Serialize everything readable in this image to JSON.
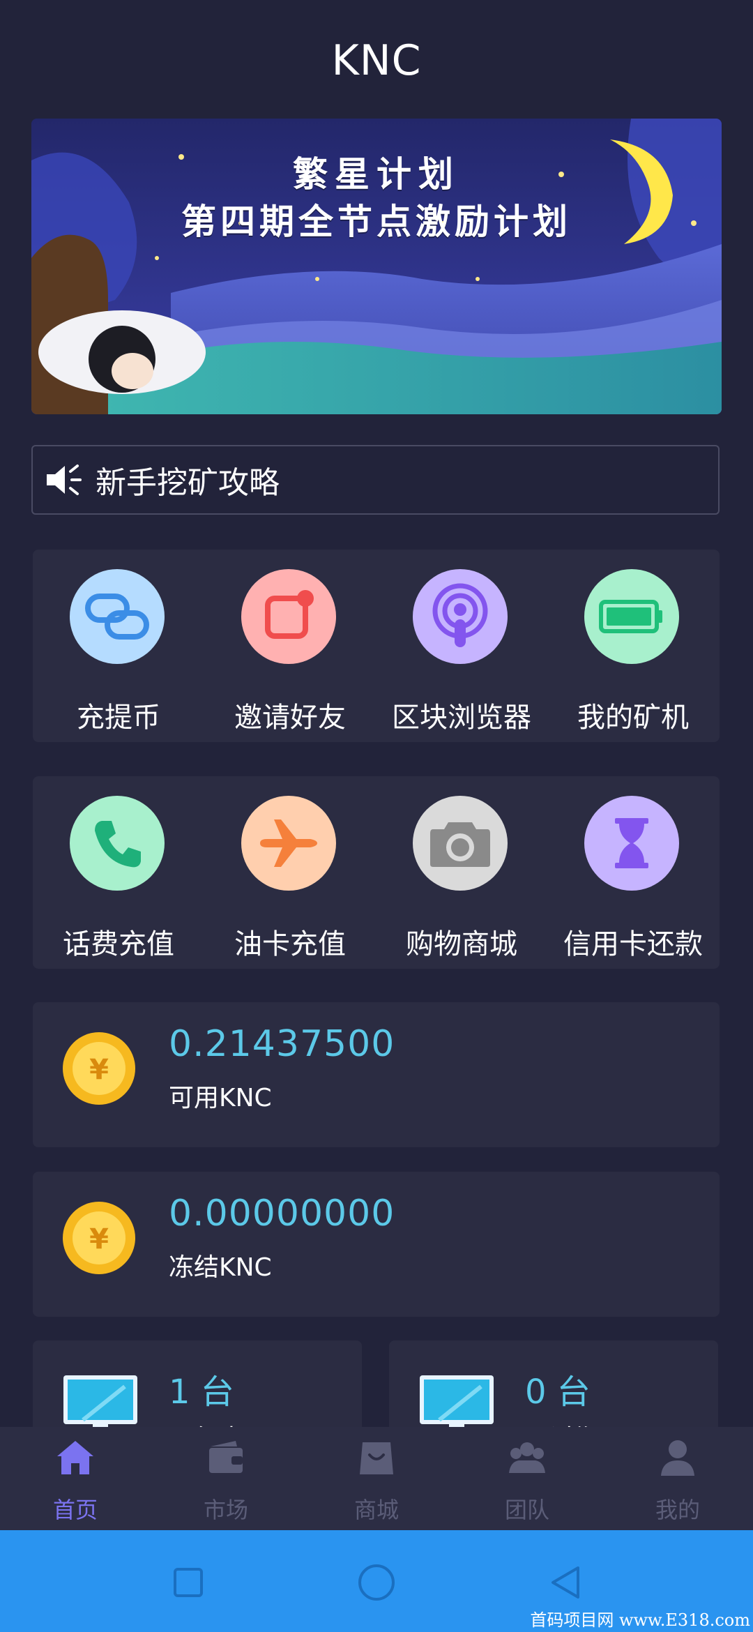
{
  "header": {
    "title": "KNC"
  },
  "banner": {
    "line1": "繁星计划",
    "line2": "第四期全节点激励计划"
  },
  "notice": {
    "text": "新手挖矿攻略",
    "icon": "speaker-icon"
  },
  "grid1": [
    {
      "label": "充提币",
      "icon": "link-icon",
      "color": "#b5dcff"
    },
    {
      "label": "邀请好友",
      "icon": "notification-square-icon",
      "color": "#ffb1b1"
    },
    {
      "label": "区块浏览器",
      "icon": "podcast-icon",
      "color": "#c6b4ff"
    },
    {
      "label": "我的矿机",
      "icon": "battery-icon",
      "color": "#a8f0cd"
    }
  ],
  "grid2": [
    {
      "label": "话费充值",
      "icon": "phone-icon",
      "color": "#a8f0cd"
    },
    {
      "label": "油卡充值",
      "icon": "airplane-icon",
      "color": "#ffcfae"
    },
    {
      "label": "购物商城",
      "icon": "camera-icon",
      "color": "#dadada"
    },
    {
      "label": "信用卡还款",
      "icon": "hourglass-icon",
      "color": "#c6b4ff"
    }
  ],
  "balances": [
    {
      "value": "0.21437500",
      "label": "可用KNC",
      "icon": "yuan-coin-icon"
    },
    {
      "value": "0.00000000",
      "label": "冻结KNC",
      "icon": "yuan-coin-icon"
    }
  ],
  "machines": [
    {
      "value": "1 台",
      "label": "运行中",
      "icon": "monitor-icon"
    },
    {
      "value": "0 台",
      "label": "已过期",
      "icon": "monitor-icon"
    }
  ],
  "tabbar": [
    {
      "label": "首页",
      "icon": "home-icon",
      "active": true
    },
    {
      "label": "市场",
      "icon": "wallet-icon",
      "active": false
    },
    {
      "label": "商城",
      "icon": "shopping-bag-icon",
      "active": false
    },
    {
      "label": "团队",
      "icon": "team-icon",
      "active": false
    },
    {
      "label": "我的",
      "icon": "user-icon",
      "active": false
    }
  ],
  "system_nav": [
    "recents-button",
    "home-button",
    "back-button"
  ],
  "watermark": "首码项目网 www.E318.com",
  "colors": {
    "background": "#22233a",
    "card": "#2b2c42",
    "accent_value": "#5cc9e8",
    "tab_active": "#7b73f0",
    "tab_inactive": "#5b5d78",
    "system_nav": "#2a94f0"
  }
}
